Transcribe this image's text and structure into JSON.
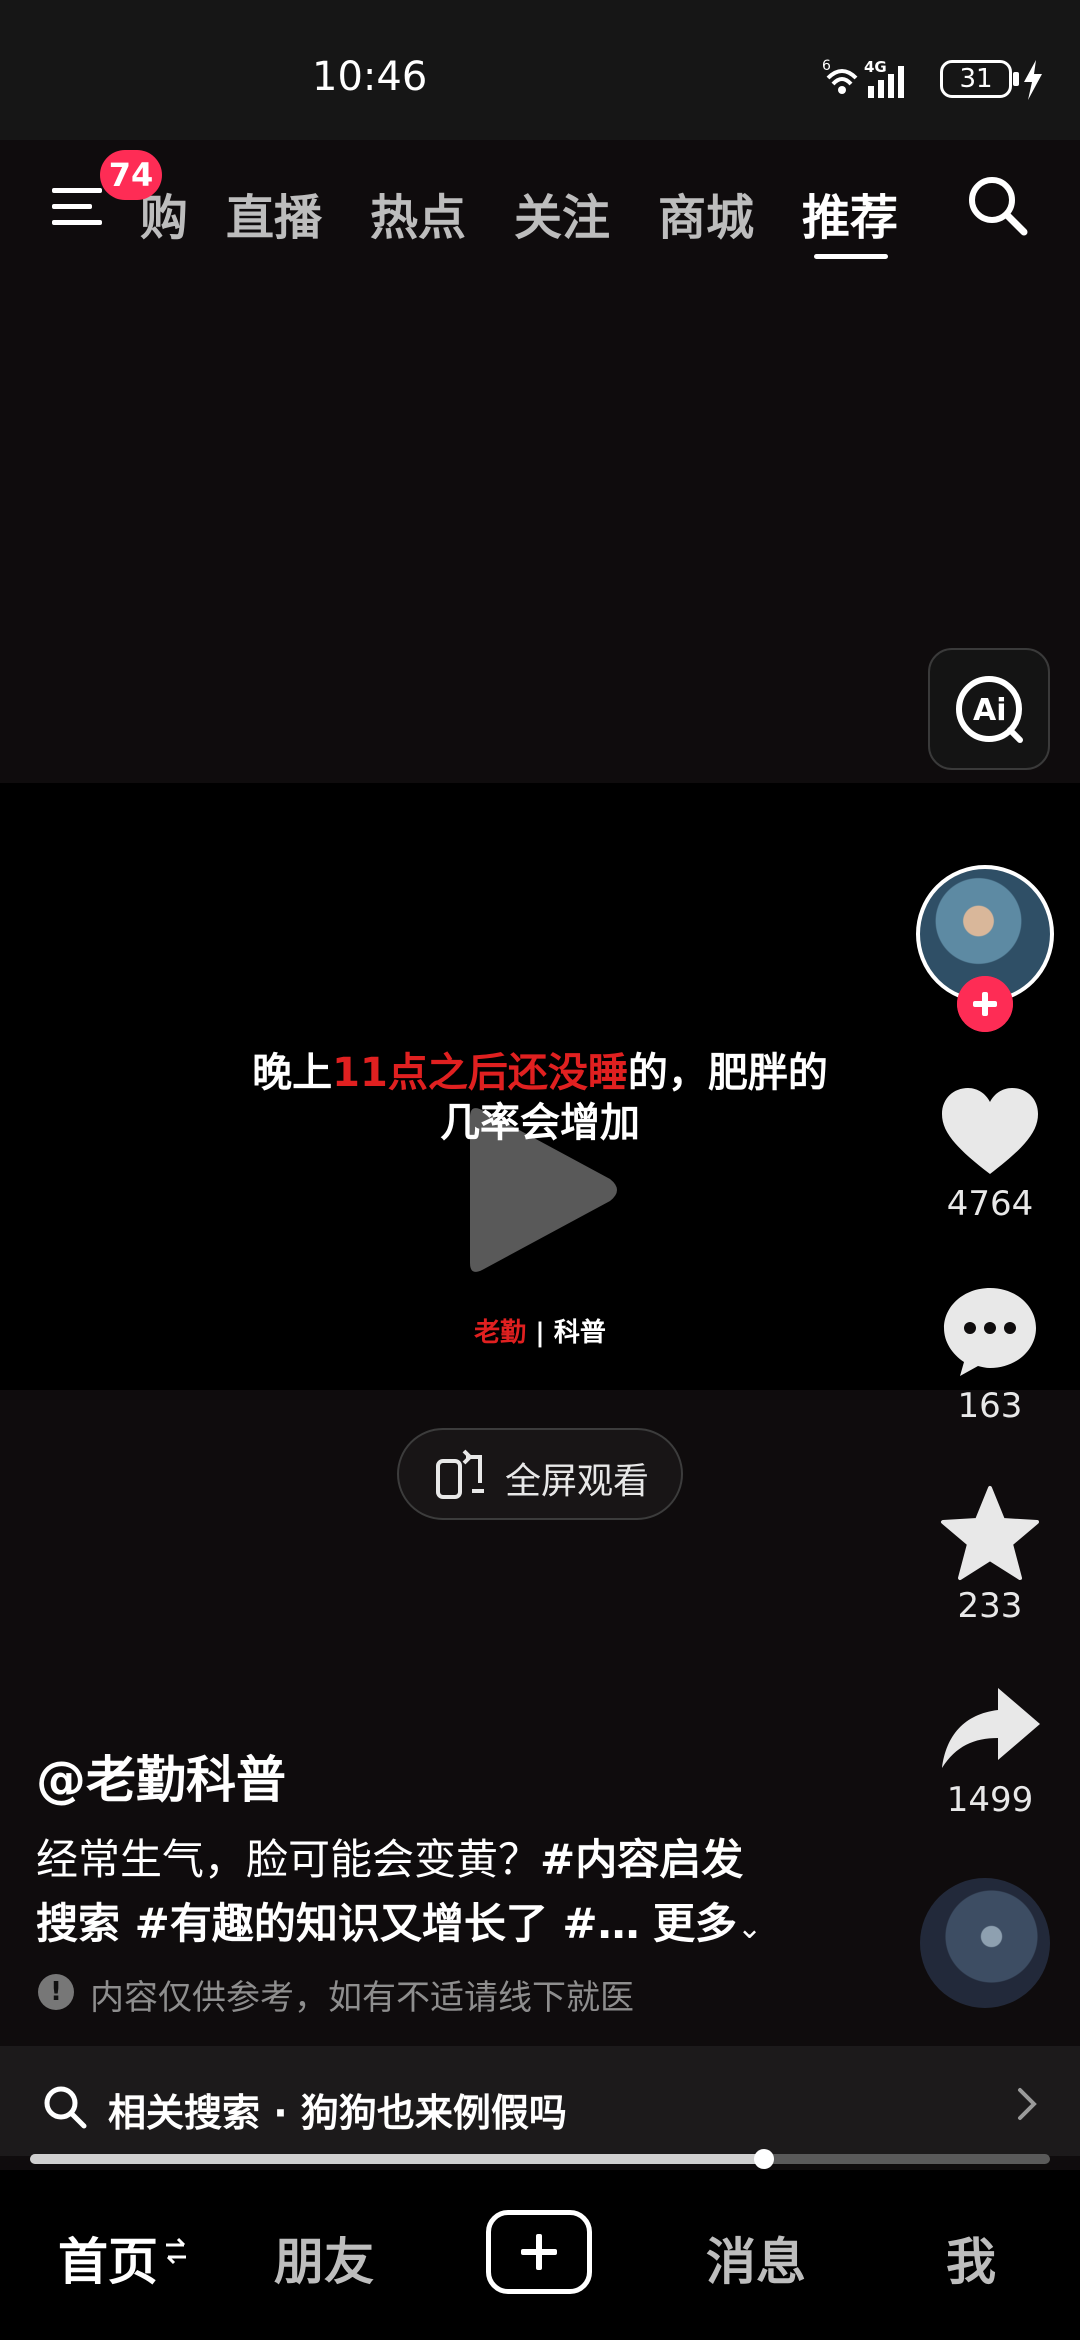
{
  "status": {
    "time": "10:46",
    "battery": "31",
    "network": "4G",
    "wifi_level": "6"
  },
  "top_nav": {
    "badge": "74",
    "partial_tab": "购",
    "tabs": [
      "直播",
      "热点",
      "关注",
      "商城",
      "推荐"
    ],
    "active_tab": "推荐"
  },
  "video": {
    "line1_pre": "晚上",
    "line1_red": "11点之后还没睡",
    "line1_post": "的，肥胖的",
    "line2": "几率会增加",
    "brand_red": "老勤",
    "brand_sep": "|",
    "brand_white": "科普"
  },
  "fullscreen_label": "全屏观看",
  "rail": {
    "likes": "4764",
    "comments": "163",
    "favorites": "233",
    "shares": "1499"
  },
  "caption": {
    "author": "@老勤科普",
    "line1_text": "经常生气，脸可能会变黄？",
    "line1_tag": "#内容启发",
    "line2_tag": "搜索 #有趣的知识又增长了 #…",
    "more": "更多",
    "warning": "内容仅供参考，如有不适请线下就医"
  },
  "related_search": "相关搜索 · 狗狗也来例假吗",
  "progress": {
    "fraction": 0.72
  },
  "bottom_nav": {
    "home": "首页",
    "friends": "朋友",
    "messages": "消息",
    "me": "我"
  },
  "colors": {
    "accent": "#fe2c55",
    "highlight_red": "#e02020",
    "background": "#0f0c0d"
  },
  "icons": [
    "menu-icon",
    "search-icon",
    "ai-icon",
    "play-icon",
    "phone-rotate-icon",
    "heart-icon",
    "comment-icon",
    "star-icon",
    "share-icon",
    "plus-icon",
    "warning-icon",
    "chevron-right-icon",
    "swap-icon"
  ]
}
